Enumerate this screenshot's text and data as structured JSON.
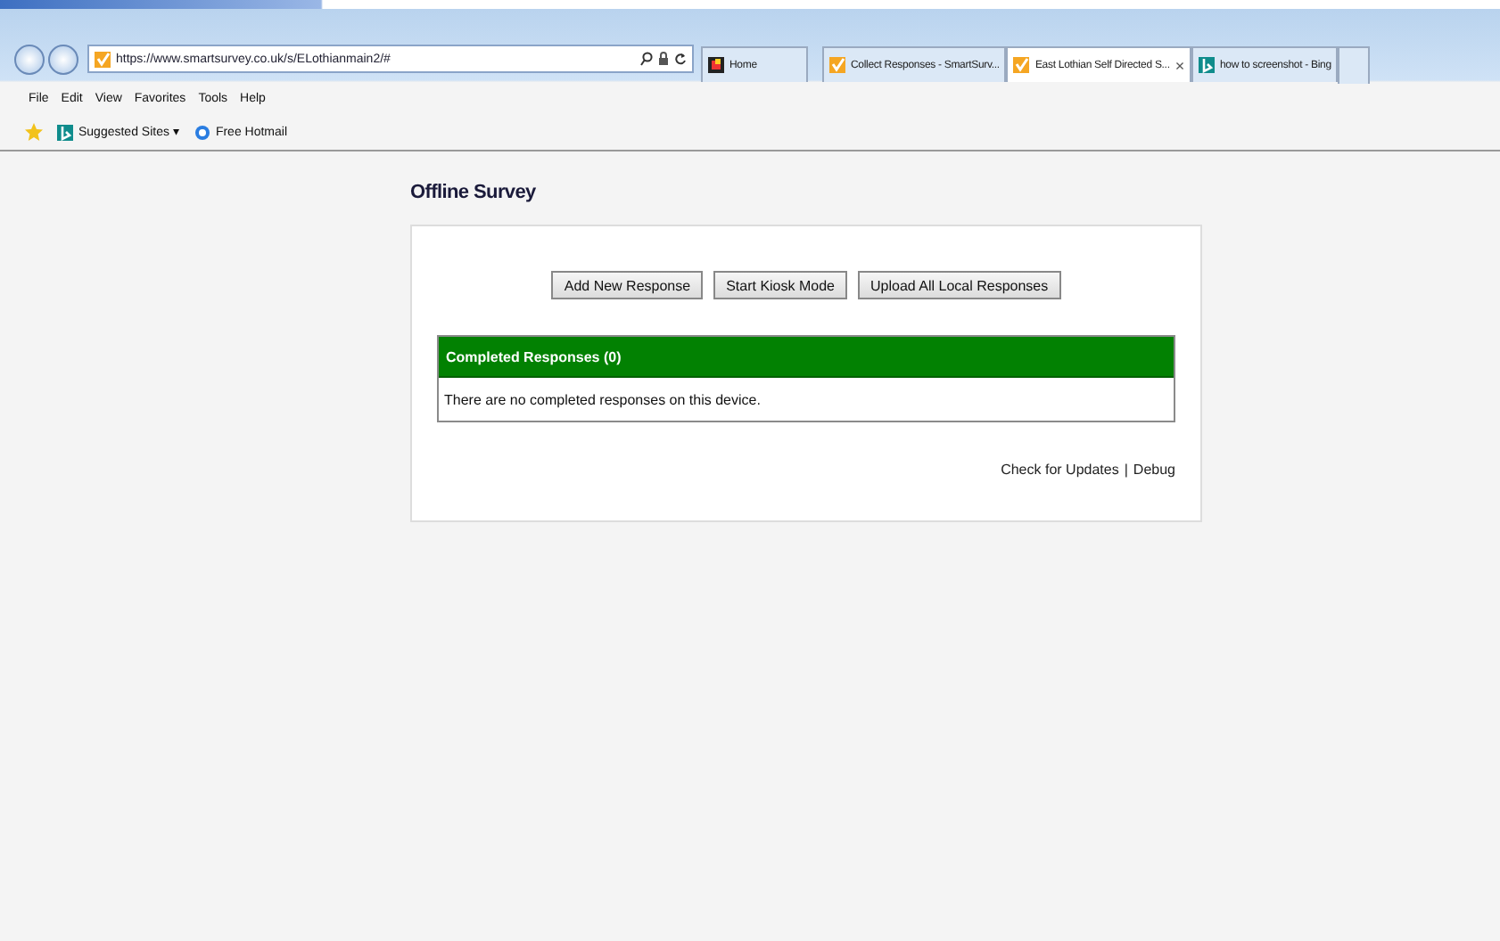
{
  "browser": {
    "address": "https://www.smartsurvey.co.uk/s/ELothianmain2/#",
    "tabs": [
      {
        "label": "Home",
        "selected": false
      },
      {
        "label": "Collect Responses - SmartSurv...",
        "selected": false
      },
      {
        "label": "East Lothian Self Directed S...",
        "selected": true,
        "close": "×"
      },
      {
        "label": "how to screenshot - Bing",
        "selected": false
      }
    ],
    "menu": [
      "File",
      "Edit",
      "View",
      "Favorites",
      "Tools",
      "Help"
    ],
    "favorites": [
      "Suggested Sites ▾",
      "Free Hotmail"
    ]
  },
  "page": {
    "title": "Offline Survey",
    "buttons": [
      "Add New Response",
      "Start Kiosk Mode",
      "Upload All Local Responses"
    ],
    "panel": {
      "header": "Completed Responses (0)",
      "message": "There are no completed responses on this device."
    },
    "footer_links": [
      "Check for Updates",
      "Debug"
    ],
    "separator": "|"
  }
}
